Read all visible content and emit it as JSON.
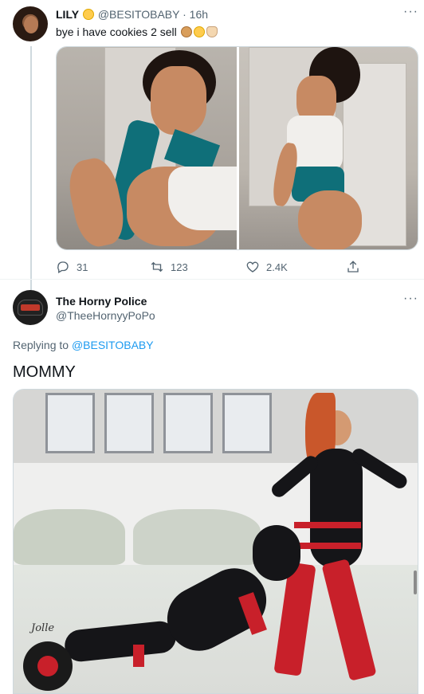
{
  "tweet1": {
    "name": "LILY",
    "handle": "@BESITOBABY",
    "time": "· 16h",
    "text": "bye i have cookies 2 sell",
    "name_emoji": "rolling-eyes-icon",
    "text_emojis": [
      "cookie-icon",
      "rolling-eyes-icon",
      "peace-hand-icon"
    ],
    "stats": {
      "replies": "31",
      "retweets": "123",
      "likes": "2.4K"
    },
    "more": "···"
  },
  "tweet2": {
    "name": "The Horny Police",
    "handle": "@TheeHornyyPoPo",
    "replying_prefix": "Replying to ",
    "replying_to": "@BESITOBABY",
    "text": "MOMMY",
    "more": "···",
    "image_signature": "Jolle"
  },
  "colors": {
    "link": "#1d9bf0",
    "muted": "#536471",
    "text": "#0f1419",
    "teal": "#0f6f79",
    "red": "#c8202a"
  }
}
